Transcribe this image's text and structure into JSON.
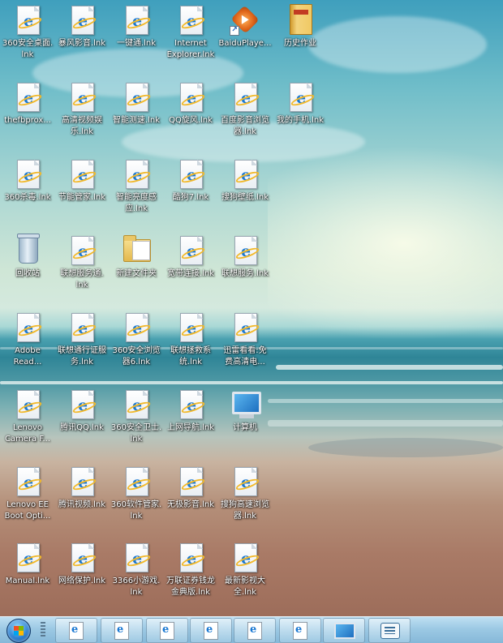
{
  "desktop": {
    "icons": [
      {
        "name": "360安全桌面.lnk",
        "label": "360安全桌面.\nlnk",
        "type": "ie-shortcut"
      },
      {
        "name": "暴风影音.lnk",
        "label": "暴风影音.lnk",
        "type": "ie-shortcut"
      },
      {
        "name": "一键通.lnk",
        "label": "一键通.lnk",
        "type": "ie-shortcut"
      },
      {
        "name": "Internet Explorer.lnk",
        "label": "Internet\nExplorer.lnk",
        "type": "ie-shortcut"
      },
      {
        "name": "BaiduPlayer",
        "label": "BaiduPlaye...",
        "type": "player"
      },
      {
        "name": "历史作业",
        "label": "历史作业",
        "type": "book"
      },
      {
        "name": "thefbprox.lnk",
        "label": "thefbprox...",
        "type": "ie-shortcut"
      },
      {
        "name": "高清视频娱乐.lnk",
        "label": "高清视频娱\n乐.lnk",
        "type": "ie-shortcut"
      },
      {
        "name": "智能测速.lnk",
        "label": "智能测速.lnk",
        "type": "ie-shortcut"
      },
      {
        "name": "QQ旋风.lnk",
        "label": "QQ旋风.lnk",
        "type": "ie-shortcut"
      },
      {
        "name": "百度影音浏览器.lnk",
        "label": "百度影音浏览\n器.lnk",
        "type": "ie-shortcut"
      },
      {
        "name": "我的手机.lnk",
        "label": "我的手机.lnk",
        "type": "ie-shortcut"
      },
      {
        "name": "360杀毒.lnk",
        "label": "360杀毒.lnk",
        "type": "ie-shortcut"
      },
      {
        "name": "节能管家.lnk",
        "label": "节能管家.lnk",
        "type": "ie-shortcut"
      },
      {
        "name": "智能亮度感应.lnk",
        "label": "智能亮度感\n应.lnk",
        "type": "ie-shortcut"
      },
      {
        "name": "酷狗7.lnk",
        "label": "酷狗7.lnk",
        "type": "ie-shortcut"
      },
      {
        "name": "搜狗壁纸.lnk",
        "label": "搜狗壁纸.lnk",
        "type": "ie-shortcut"
      },
      {
        "name": "回收站",
        "label": "回收站",
        "type": "recycle-bin"
      },
      {
        "name": "联想服务通.lnk",
        "label": "联想服务通.\nlnk",
        "type": "ie-shortcut"
      },
      {
        "name": "新建文件夹",
        "label": "新建文件夹",
        "type": "folder"
      },
      {
        "name": "宽带连接.lnk",
        "label": "宽带连接.lnk",
        "type": "ie-shortcut"
      },
      {
        "name": "联想服务.lnk",
        "label": "联想服务.lnk",
        "type": "ie-shortcut"
      },
      {
        "name": "Adobe Reader",
        "label": "Adobe\nRead...",
        "type": "ie-shortcut"
      },
      {
        "name": "联想通行证服务.lnk",
        "label": "联想通行证服\n务.lnk",
        "type": "ie-shortcut"
      },
      {
        "name": "360安全浏览器6.lnk",
        "label": "360安全浏览\n器6.lnk",
        "type": "ie-shortcut"
      },
      {
        "name": "联想拯救系统.lnk",
        "label": "联想拯救系\n统.lnk",
        "type": "ie-shortcut"
      },
      {
        "name": "迅雷看看免费高清电影",
        "label": "迅雷看看:免\n费高清电...",
        "type": "ie-shortcut"
      },
      {
        "name": "Lenovo Camera F",
        "label": "Lenovo\nCamera F...",
        "type": "ie-shortcut"
      },
      {
        "name": "腾讯QQ.lnk",
        "label": "腾讯QQ.lnk",
        "type": "ie-shortcut"
      },
      {
        "name": "360安全卫士.lnk",
        "label": "360安全卫士.\nlnk",
        "type": "ie-shortcut"
      },
      {
        "name": "上网导航.lnk",
        "label": "上网导航.lnk",
        "type": "ie-shortcut"
      },
      {
        "name": "计算机",
        "label": "计算机",
        "type": "computer"
      },
      {
        "name": "Lenovo EE Boot Optimizer",
        "label": "Lenovo EE\nBoot Opti...",
        "type": "ie-shortcut"
      },
      {
        "name": "腾讯视频.lnk",
        "label": "腾讯视频.lnk",
        "type": "ie-shortcut"
      },
      {
        "name": "360软件管家.lnk",
        "label": "360软件管家.\nlnk",
        "type": "ie-shortcut"
      },
      {
        "name": "无极影音.lnk",
        "label": "无极影音.lnk",
        "type": "ie-shortcut"
      },
      {
        "name": "搜狗高速浏览器.lnk",
        "label": "搜狗高速浏览\n器.lnk",
        "type": "ie-shortcut"
      },
      {
        "name": "Manual.lnk",
        "label": "Manual.lnk",
        "type": "ie-shortcut"
      },
      {
        "name": "网络保护.lnk",
        "label": "网络保护.lnk",
        "type": "ie-shortcut"
      },
      {
        "name": "3366小游戏.lnk",
        "label": "3366小游戏.\nlnk",
        "type": "ie-shortcut"
      },
      {
        "name": "万联证券钱龙金典版.lnk",
        "label": "万联证券钱龙\n金典版.lnk",
        "type": "ie-shortcut"
      },
      {
        "name": "最新影视大全.lnk",
        "label": "最新影视大\n全.lnk",
        "type": "ie-shortcut"
      }
    ]
  },
  "taskbar": {
    "start_icon": "windows-start-orb-icon",
    "buttons": [
      {
        "icon": "ie-document-icon"
      },
      {
        "icon": "ie-document-icon"
      },
      {
        "icon": "ie-document-icon"
      },
      {
        "icon": "ie-document-icon"
      },
      {
        "icon": "ie-document-icon"
      },
      {
        "icon": "ie-document-icon"
      },
      {
        "icon": "display-icon"
      },
      {
        "icon": "chat-window-icon"
      }
    ]
  },
  "colors": {
    "taskbar": "#9cc9e4",
    "icon_label": "#ffffff",
    "ie_blue": "#1a78d2"
  }
}
